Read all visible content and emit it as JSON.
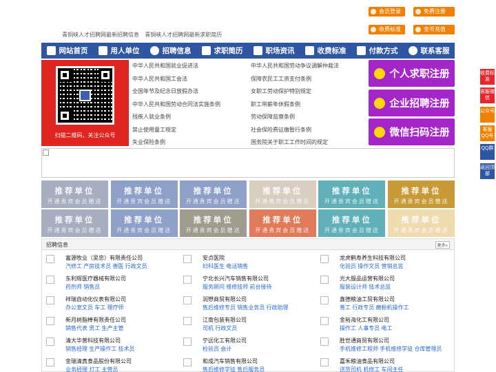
{
  "header": {
    "slogans": [
      "青铜峡人才招聘网最新招聘信息",
      "青铜峡人才招聘网最新求职简历"
    ]
  },
  "top_buttons": [
    "会员登录",
    "免费注册",
    "收费标准",
    "金币充值"
  ],
  "nav": [
    {
      "label": "网站首页",
      "icon": "home-icon"
    },
    {
      "label": "用人单位",
      "icon": "building-icon"
    },
    {
      "label": "招聘信息",
      "icon": "chat-icon"
    },
    {
      "label": "求职简历",
      "icon": "resume-icon"
    },
    {
      "label": "职场资讯",
      "icon": "news-icon"
    },
    {
      "label": "收费标准",
      "icon": "fee-icon"
    },
    {
      "label": "付款方式",
      "icon": "payment-icon"
    },
    {
      "label": "联系客服",
      "icon": "phone-icon"
    }
  ],
  "qr_caption": "扫描二维码，关注公众号",
  "laws_left": [
    "中华人民共和国就业促进法",
    "中华人民共和国工会法",
    "全国年节及纪念日放假办法",
    "中华人民共和国劳动合同法实施条例",
    "残疾人就业条例",
    "禁止使用童工规定",
    "失业保险条例"
  ],
  "laws_right": [
    "中华人民共和国劳动争议调解仲裁法",
    "保障农民工工资支付条例",
    "女职工劳动保护特别规定",
    "职工带薪年休假条例",
    "劳动保障监察条例",
    "社会保险费征缴暂行条例",
    "国务院关于职工工作时间的规定"
  ],
  "register_buttons": [
    "个人求职注册",
    "企业招聘注册",
    "微信扫码注册"
  ],
  "recommend": {
    "title": "推荐单位",
    "subtitle": "开通贵宾会员赠送",
    "colors": [
      "#a6aec0",
      "#8fa0c8",
      "#8fa0c8",
      "#d8cfc0",
      "#5fb0b8",
      "#c89a36",
      "#a6aec0",
      "#8fa0c8",
      "#9e9c8c",
      "#e07a5a",
      "#5fb0b8",
      "#eedcb0"
    ]
  },
  "jobs": {
    "title": "招聘信息",
    "more": "更多»",
    "companies": [
      {
        "name": "富源牧业（吴忠）有限责任公司",
        "positions": "汽修工 产房技术员 兽医 行政文员"
      },
      {
        "name": "安贞医院",
        "positions": "妇科医生 电话销售"
      },
      {
        "name": "龙虎鹤寿养生科技有限公司",
        "positions": "化验员 操作文员 营销总监"
      },
      {
        "name": "东利辉医疗器械有限公司",
        "positions": "药剂师 销售员"
      },
      {
        "name": "宁北长兴汽车销售有限公司",
        "positions": "服务顾问 维修技师 前台接待"
      },
      {
        "name": "光大服品运营有限公司",
        "positions": "服装设计师 技术总监"
      },
      {
        "name": "祥瑞自动化仪表有限公司",
        "positions": "办公室文员 车工 理疗师"
      },
      {
        "name": "润懋商贸有限公司",
        "positions": "售后维修专员 销售业务员 行政助理"
      },
      {
        "name": "鑫德粮油工贸有限公司",
        "positions": "普工 行政专员 磨粉机操作工"
      },
      {
        "name": "新月树脂棒有限责任公司",
        "positions": "销售代表 男工 生产主管"
      },
      {
        "name": "江南包装有限公司",
        "positions": "司机 行政文员"
      },
      {
        "name": "金裕海化工有限公司",
        "positions": "操作工 人事专员 电工"
      },
      {
        "name": "清大华普科技有限公司",
        "positions": "销售经理 生产操作工 技术员"
      },
      {
        "name": "宁远化工有限公司",
        "positions": "检验员 会计"
      },
      {
        "name": "胜世通商贸有限公司",
        "positions": "手机维修工程师 手机维修学徒 仓库管理员"
      },
      {
        "name": "金瑞清真食品股份有限公司",
        "positions": "业务经理 灯工 主营员"
      },
      {
        "name": "和成汽车销售有限公司",
        "positions": "售后维修学徒 售后服务员"
      },
      {
        "name": "嘉禾粮油食品有限公司",
        "positions": "送货司机 机修工 车间主任"
      }
    ]
  },
  "side_buttons": [
    {
      "label": "收费标准",
      "color": "#e8262b"
    },
    {
      "label": "客服微信",
      "color": "#e8262b"
    },
    {
      "label": "公众号",
      "color": "#f08000"
    },
    {
      "label": "客服QQ号",
      "color": "#f08000"
    },
    {
      "label": "QQ群",
      "color": "#2f56a3"
    },
    {
      "label": "返回顶部",
      "color": "#2f56a3"
    }
  ]
}
